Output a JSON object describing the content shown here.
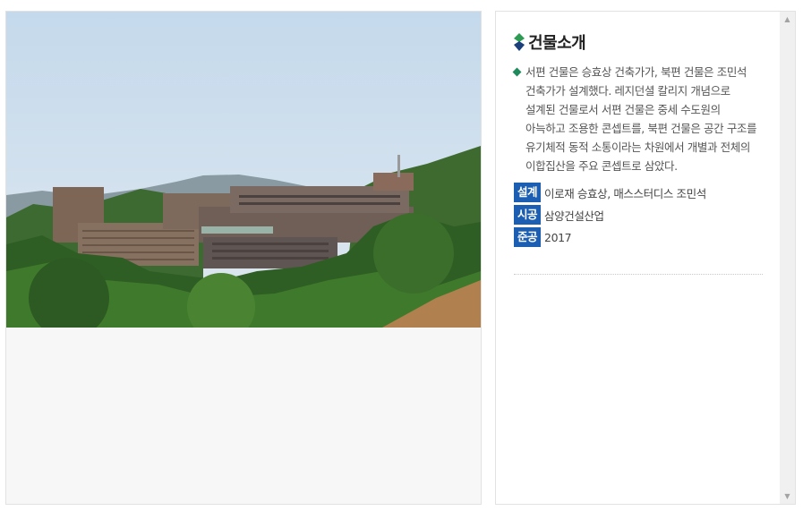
{
  "photo": {
    "icon": "building-photo",
    "alt": ""
  },
  "intro": {
    "title": "건물소개",
    "title_icon": "diamond-bullet-icon",
    "description": "서편 건물은 승효상 건축가가, 북편 건물은 조민석 건축가가 설계했다. 레지던셜 칼리지 개념으로 설계된 건물로서 서편 건물은 중세 수도원의 아늑하고 조용한 콘셉트를, 북편 건물은 공간 구조를 유기체적 동적 소통이라는 차원에서 개별과 전체의 이합집산을 주요 콘셉트로 삼았다.",
    "info": [
      {
        "label": "설계",
        "value": "이로재 승효상, 매스스터디스 조민석"
      },
      {
        "label": "시공",
        "value": "삼양건설산업"
      },
      {
        "label": "준공",
        "value": "2017"
      }
    ]
  },
  "scrollbar": {
    "up": "▲",
    "down": "▼"
  },
  "colors": {
    "label_bg": "#1c5fb2",
    "bullet": "#1f8a5b",
    "title_icon_top": "#2e9b53",
    "title_icon_bottom": "#1a3f7a"
  }
}
